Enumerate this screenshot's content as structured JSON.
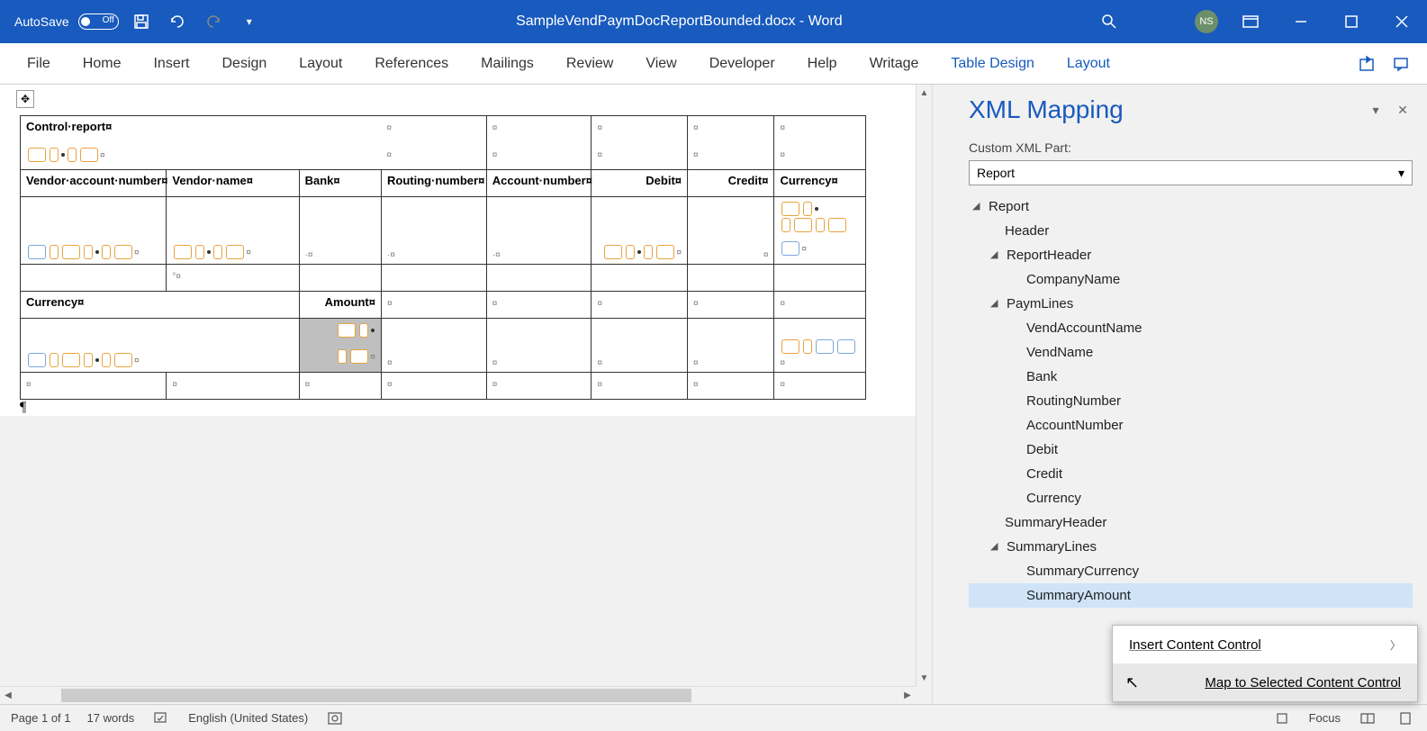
{
  "titlebar": {
    "autosave_label": "AutoSave",
    "autosave_state": "Off",
    "document_title": "SampleVendPaymDocReportBounded.docx  -  Word",
    "user_initials": "NS"
  },
  "ribbon": {
    "tabs": [
      "File",
      "Home",
      "Insert",
      "Design",
      "Layout",
      "References",
      "Mailings",
      "Review",
      "View",
      "Developer",
      "Help",
      "Writage"
    ],
    "context_tabs": [
      "Table Design",
      "Layout"
    ]
  },
  "document": {
    "title": "Control·report¤",
    "columns": {
      "vendor_account": "Vendor·account·number¤",
      "vendor_name": "Vendor·name¤",
      "bank": "Bank¤",
      "routing": "Routing·number¤",
      "account_num": "Account·number¤",
      "debit": "Debit¤",
      "credit": "Credit¤",
      "currency_col": "Currency¤"
    },
    "summary": {
      "currency": "Currency¤",
      "amount": "Amount¤"
    }
  },
  "xml_pane": {
    "title": "XML Mapping",
    "part_label": "Custom XML Part:",
    "selected_part": "Report",
    "tree": {
      "root": "Report",
      "header": "Header",
      "report_header": "ReportHeader",
      "company_name": "CompanyName",
      "paym_lines": "PaymLines",
      "vend_account_name": "VendAccountName",
      "vend_name": "VendName",
      "bank": "Bank",
      "routing_number": "RoutingNumber",
      "account_number": "AccountNumber",
      "debit": "Debit",
      "credit": "Credit",
      "currency": "Currency",
      "summary_header": "SummaryHeader",
      "summary_lines": "SummaryLines",
      "summary_currency": "SummaryCurrency",
      "summary_amount": "SummaryAmount"
    }
  },
  "context_menu": {
    "insert": "Insert Content Control",
    "map": "Map to Selected Content Control"
  },
  "statusbar": {
    "page": "Page 1 of 1",
    "words": "17 words",
    "language": "English (United States)",
    "focus": "Focus"
  }
}
